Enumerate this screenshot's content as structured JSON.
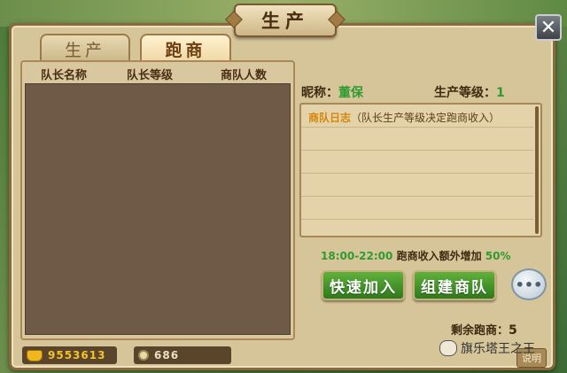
{
  "window": {
    "title": "生产",
    "close_glyph": "✕"
  },
  "tabs": [
    {
      "label": "生产",
      "active": false
    },
    {
      "label": "跑商",
      "active": true
    }
  ],
  "list": {
    "columns": [
      "队长名称",
      "队长等级",
      "商队人数"
    ],
    "rows": []
  },
  "info": {
    "nickname_label": "昵称：",
    "nickname_value": "董保",
    "level_label": "生产等级：",
    "level_value": "1"
  },
  "log": {
    "tag": "商队日志",
    "text": "（队长生产等级决定跑商收入）"
  },
  "bonus": {
    "time_range": "18:00-22:00",
    "text": "跑商收入额外增加",
    "percent": "50%"
  },
  "buttons": {
    "quick_join": "快速加入",
    "create_team": "组建商队",
    "chat_icon": "chat-bubble-icon"
  },
  "remaining": {
    "label": "剩余跑商：",
    "value": "5"
  },
  "currency": {
    "gold": "9553613",
    "coin": "686"
  },
  "help_label": "说明",
  "watermark": "旗乐塔王之王",
  "colors": {
    "active_green": "#2f9b2f",
    "button_green": "#3f9527",
    "gold": "#f3c325"
  }
}
